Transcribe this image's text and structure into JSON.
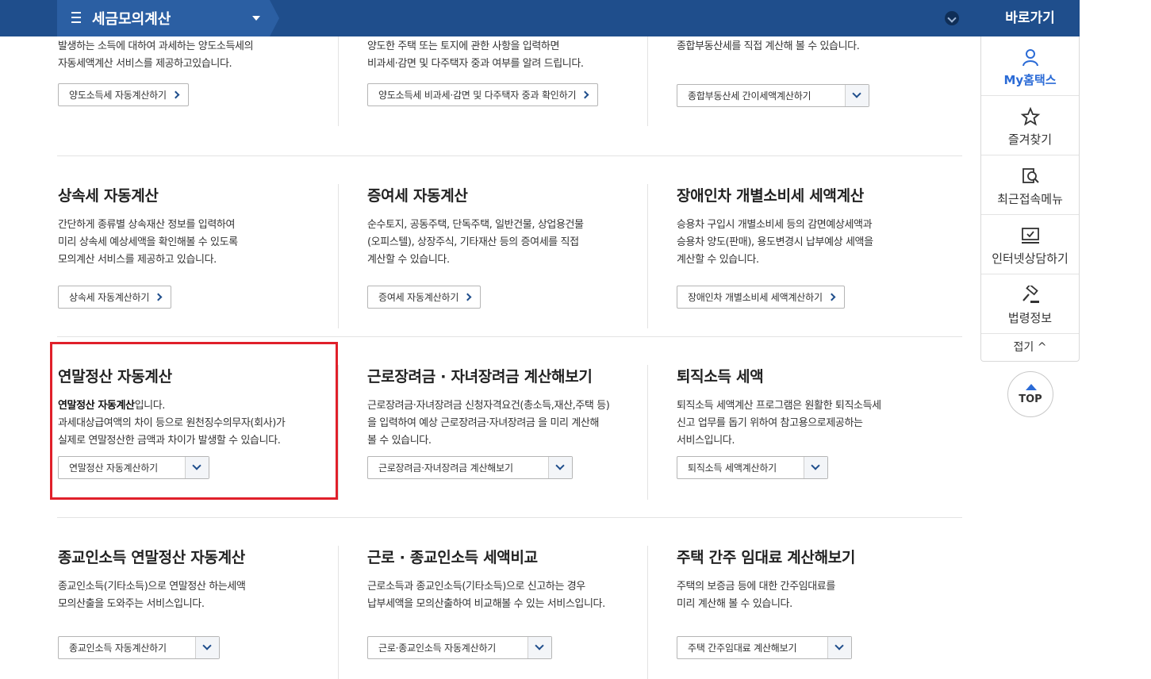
{
  "header": {
    "title": "세금모의계산"
  },
  "quick_menu": {
    "title": "바로가기",
    "items": [
      {
        "label": "My홈택스",
        "icon": "person-icon"
      },
      {
        "label": "즐겨찾기",
        "icon": "star-icon"
      },
      {
        "label": "최근접속메뉴",
        "icon": "recent-search-icon"
      },
      {
        "label": "인터넷상담하기",
        "icon": "monitor-icon"
      },
      {
        "label": "법령정보",
        "icon": "gavel-icon"
      }
    ],
    "fold_label": "접기 ^",
    "top_label": "TOP"
  },
  "cards": [
    {
      "title": "",
      "lines": [
        "발생하는 소득에 대하여 과세하는 양도소득세의",
        "자동세액계산 서비스를 제공하고있습니다."
      ],
      "button": "양도소득세 자동계산하기",
      "button_type": "link"
    },
    {
      "title": "",
      "lines": [
        "양도한 주택 또는 토지에 관한 사항을 입력하면",
        "비과세·감면 및 다주택자 중과 여부를 알려 드립니다."
      ],
      "button": "양도소득세 비과세·감면 및 다주택자 중과 확인하기",
      "button_type": "link"
    },
    {
      "title": "",
      "lines": [
        "종합부동산세를 직접 계산해 볼 수 있습니다."
      ],
      "button": "종합부동산세 간이세액계산하기",
      "button_type": "dropdown"
    },
    {
      "title": "상속세 자동계산",
      "lines": [
        "간단하게 종류별 상속재산 정보를 입력하여",
        "미리 상속세 예상세액을 확인해볼 수 있도록",
        "모의계산 서비스를 제공하고 있습니다."
      ],
      "button": "상속세 자동계산하기",
      "button_type": "link"
    },
    {
      "title": "증여세 자동계산",
      "lines": [
        "순수토지, 공동주택, 단독주택, 일반건물, 상업용건물",
        "(오피스텔), 상장주식, 기타재산 등의 증여세를 직접",
        "계산할 수 있습니다."
      ],
      "button": "증여세 자동계산하기",
      "button_type": "link"
    },
    {
      "title": "장애인차 개별소비세 세액계산",
      "lines": [
        "승용차 구입시 개별소비세 등의 감면예상세액과",
        "승용차 양도(판매), 용도변경시 납부예상 세액을",
        "계산할 수 있습니다."
      ],
      "button": "장애인차 개별소비세 세액계산하기",
      "button_type": "link"
    },
    {
      "title": "연말정산 자동계산",
      "lead_bold": "연말정산 자동계산",
      "lead_rest": "입니다.",
      "lines": [
        "과세대상급여액의 차이 등으로 원천징수의무자(회사)가",
        "실제로 연말정산한 금액과 차이가 발생할 수 있습니다."
      ],
      "button": "연말정산 자동계산하기",
      "button_type": "dropdown"
    },
    {
      "title": "근로장려금 · 자녀장려금 계산해보기",
      "lines": [
        "근로장려금·자녀장려금 신청자격요건(총소득,재산,주택 등)",
        "을 입력하여 예상 근로장려금·자녀장려금 을 미리 계산해",
        "볼 수 있습니다."
      ],
      "button": "근로장려금·자녀장려금 계산해보기",
      "button_type": "dropdown"
    },
    {
      "title": "퇴직소득 세액",
      "lines": [
        "퇴직소득 세액계산 프로그램은 원활한 퇴직소득세",
        "신고 업무를 돕기 위하여 참고용으로제공하는",
        "서비스입니다."
      ],
      "button": "퇴직소득 세액계산하기",
      "button_type": "dropdown"
    },
    {
      "title": "종교인소득 연말정산 자동계산",
      "lines": [
        "종교인소득(기타소득)으로 연말정산 하는세액",
        "모의산출을 도와주는 서비스입니다."
      ],
      "button": "종교인소득 자동계산하기",
      "button_type": "dropdown"
    },
    {
      "title": "근로 · 종교인소득 세액비교",
      "lines": [
        "근로소득과 종교인소득(기타소득)으로 신고하는 경우",
        "납부세액을 모의산출하여 비교해볼 수 있는 서비스입니다."
      ],
      "button": "근로·종교인소득 자동계산하기",
      "button_type": "dropdown"
    },
    {
      "title": "주택 간주 임대료 계산해보기",
      "lines": [
        "주택의 보증금 등에 대한 간주임대료를",
        "미리 계산해 볼 수 있습니다."
      ],
      "button": "주택 간주임대료 계산해보기",
      "button_type": "dropdown"
    }
  ]
}
